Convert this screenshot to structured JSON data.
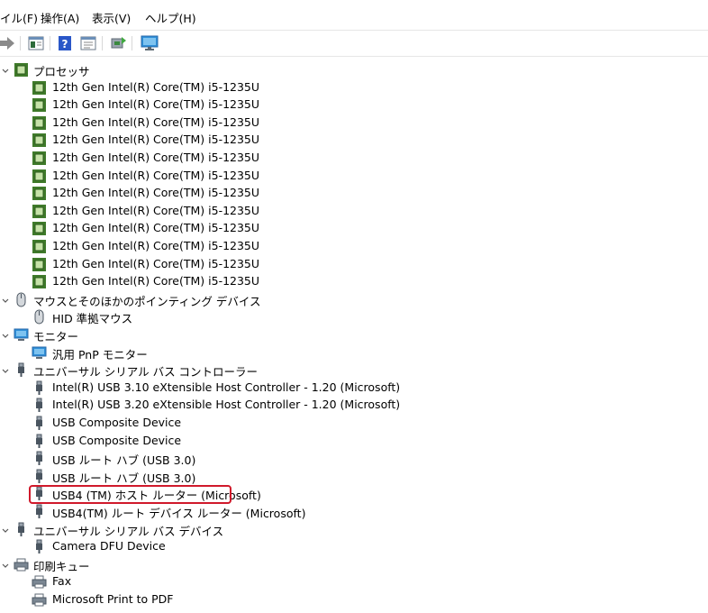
{
  "menu": [
    "イル(F)",
    "操作(A)",
    "表示(V)",
    "ヘルプ(H)"
  ],
  "toolbar": {
    "icons": [
      "forward-arrow-icon",
      "properties-icon",
      "help-icon",
      "view-icon",
      "update-driver-icon",
      "scan-hardware-icon"
    ]
  },
  "tree": {
    "categories": [
      {
        "label": "プロセッサ",
        "icon": "processor-icon",
        "expanded": true,
        "devices": [
          "12th Gen Intel(R) Core(TM) i5-1235U",
          "12th Gen Intel(R) Core(TM) i5-1235U",
          "12th Gen Intel(R) Core(TM) i5-1235U",
          "12th Gen Intel(R) Core(TM) i5-1235U",
          "12th Gen Intel(R) Core(TM) i5-1235U",
          "12th Gen Intel(R) Core(TM) i5-1235U",
          "12th Gen Intel(R) Core(TM) i5-1235U",
          "12th Gen Intel(R) Core(TM) i5-1235U",
          "12th Gen Intel(R) Core(TM) i5-1235U",
          "12th Gen Intel(R) Core(TM) i5-1235U",
          "12th Gen Intel(R) Core(TM) i5-1235U",
          "12th Gen Intel(R) Core(TM) i5-1235U"
        ]
      },
      {
        "label": "マウスとそのほかのポインティング デバイス",
        "icon": "mouse-icon",
        "expanded": true,
        "devices": [
          "HID 準拠マウス"
        ]
      },
      {
        "label": "モニター",
        "icon": "monitor-icon",
        "expanded": true,
        "devices": [
          "汎用 PnP モニター"
        ]
      },
      {
        "label": "ユニバーサル シリアル バス コントローラー",
        "icon": "usb-icon",
        "expanded": true,
        "devices": [
          "Intel(R) USB 3.10 eXtensible Host Controller - 1.20 (Microsoft)",
          "Intel(R) USB 3.20 eXtensible Host Controller - 1.20 (Microsoft)",
          "USB Composite Device",
          "USB Composite Device",
          "USB ルート ハブ (USB 3.0)",
          "USB ルート ハブ (USB 3.0)",
          "USB4 (TM) ホスト ルーター (Microsoft)",
          "USB4(TM) ルート デバイス ルーター (Microsoft)"
        ]
      },
      {
        "label": "ユニバーサル シリアル バス デバイス",
        "icon": "usb-icon",
        "expanded": true,
        "devices": [
          "Camera DFU Device"
        ]
      },
      {
        "label": "印刷キュー",
        "icon": "printer-icon",
        "expanded": true,
        "devices": [
          "Fax",
          "Microsoft Print to PDF"
        ]
      }
    ],
    "highlighted_device": "USB4 (TM) ホスト ルーター (Microsoft)"
  },
  "colors": {
    "highlight_border": "#d0192b",
    "chip_green": "#3f7a2a",
    "monitor_blue": "#2f8fd8"
  }
}
